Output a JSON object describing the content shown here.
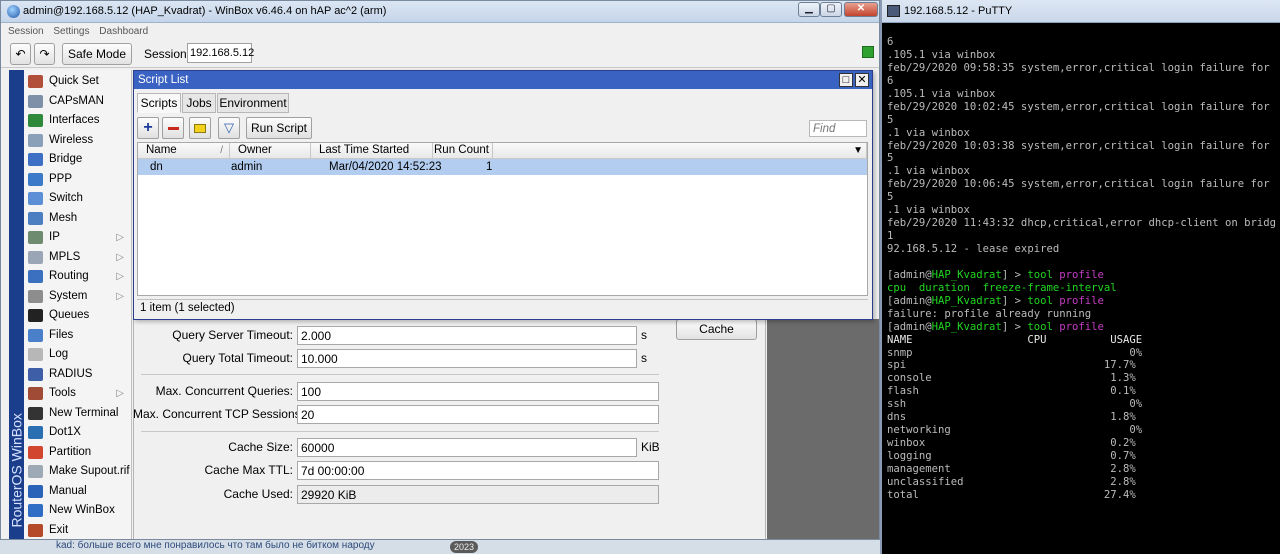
{
  "winbox": {
    "title": "admin@192.168.5.12 (HAP_Kvadrat) - WinBox v6.46.4 on hAP ac^2 (arm)",
    "menu": [
      "Session",
      "Settings",
      "Dashboard"
    ],
    "toolbar": {
      "safe_mode_label": "Safe Mode",
      "session_label": "Session:",
      "session_value": "192.168.5.12"
    },
    "brand": "RouterOS WinBox",
    "sidebar": [
      {
        "label": "Quick Set",
        "icon": "quick-set-icon",
        "color": "#b24f3a",
        "arrow": false
      },
      {
        "label": "CAPsMAN",
        "icon": "capsman-icon",
        "color": "#7e8fa8",
        "arrow": false
      },
      {
        "label": "Interfaces",
        "icon": "interfaces-icon",
        "color": "#2e8a3a",
        "arrow": false
      },
      {
        "label": "Wireless",
        "icon": "wireless-icon",
        "color": "#8aa0b8",
        "arrow": false
      },
      {
        "label": "Bridge",
        "icon": "bridge-icon",
        "color": "#3d6fc4",
        "arrow": false
      },
      {
        "label": "PPP",
        "icon": "ppp-icon",
        "color": "#3b79c9",
        "arrow": false
      },
      {
        "label": "Switch",
        "icon": "switch-icon",
        "color": "#5c8fd6",
        "arrow": false
      },
      {
        "label": "Mesh",
        "icon": "mesh-icon",
        "color": "#4c7ec2",
        "arrow": false
      },
      {
        "label": "IP",
        "icon": "ip-icon",
        "color": "#6f8b6f",
        "arrow": true
      },
      {
        "label": "MPLS",
        "icon": "mpls-icon",
        "color": "#9aa6b5",
        "arrow": true
      },
      {
        "label": "Routing",
        "icon": "routing-icon",
        "color": "#3b6fc0",
        "arrow": true
      },
      {
        "label": "System",
        "icon": "system-icon",
        "color": "#8d8d8d",
        "arrow": true
      },
      {
        "label": "Queues",
        "icon": "queues-icon",
        "color": "#222222",
        "arrow": false
      },
      {
        "label": "Files",
        "icon": "files-icon",
        "color": "#4a7fc9",
        "arrow": false
      },
      {
        "label": "Log",
        "icon": "log-icon",
        "color": "#b7b7b7",
        "arrow": false
      },
      {
        "label": "RADIUS",
        "icon": "radius-icon",
        "color": "#3f5ea8",
        "arrow": false
      },
      {
        "label": "Tools",
        "icon": "tools-icon",
        "color": "#a04b35",
        "arrow": true
      },
      {
        "label": "New Terminal",
        "icon": "terminal-icon",
        "color": "#333333",
        "arrow": false
      },
      {
        "label": "Dot1X",
        "icon": "dot1x-icon",
        "color": "#2b6fb3",
        "arrow": false
      },
      {
        "label": "Partition",
        "icon": "partition-icon",
        "color": "#d2452f",
        "arrow": false
      },
      {
        "label": "Make Supout.rif",
        "icon": "supout-icon",
        "color": "#9ea9b6",
        "arrow": false
      },
      {
        "label": "Manual",
        "icon": "manual-icon",
        "color": "#2b63b8",
        "arrow": false
      },
      {
        "label": "New WinBox",
        "icon": "winbox-icon",
        "color": "#2f6ec4",
        "arrow": false
      },
      {
        "label": "Exit",
        "icon": "exit-icon",
        "color": "#b44a2a",
        "arrow": false
      }
    ]
  },
  "script_list": {
    "title": "Script List",
    "tabs": [
      "Scripts",
      "Jobs",
      "Environment"
    ],
    "run_script_label": "Run Script",
    "find_placeholder": "Find",
    "columns": [
      "Name",
      "Owner",
      "Last Time Started",
      "Run Count"
    ],
    "rows": [
      {
        "name": "dn",
        "owner": "admin",
        "last_started": "Mar/04/2020 14:52:23",
        "run_count": "1"
      }
    ],
    "status": "1 item (1 selected)"
  },
  "dns": {
    "cache_button": "Cache",
    "fields": [
      {
        "label": "Query Server Timeout:",
        "value": "2.000",
        "unit": "s",
        "readonly": false
      },
      {
        "label": "Query Total Timeout:",
        "value": "10.000",
        "unit": "s",
        "readonly": false
      },
      {
        "label": "Max. Concurrent Queries:",
        "value": "100",
        "unit": "",
        "readonly": false
      },
      {
        "label": "Max. Concurrent TCP Sessions:",
        "value": "20",
        "unit": "",
        "readonly": false
      },
      {
        "label": "Cache Size:",
        "value": "60000",
        "unit": "KiB",
        "readonly": false
      },
      {
        "label": "Cache Max TTL:",
        "value": "7d 00:00:00",
        "unit": "",
        "readonly": false
      },
      {
        "label": "Cache Used:",
        "value": "29920 KiB",
        "unit": "",
        "readonly": true
      }
    ]
  },
  "taskbar": {
    "message": "kad: больше всего мне понравилось что там было не битком народу",
    "badge": "2023"
  },
  "putty": {
    "title": "192.168.5.12 - PuTTY",
    "lines": [
      [
        {
          "t": "6",
          "c": ""
        }
      ],
      [
        {
          "t": ".105.1 via winbox",
          "c": ""
        }
      ],
      [
        {
          "t": "feb/29/2020 09:58:35 system,error,critical login failure for",
          "c": ""
        }
      ],
      [
        {
          "t": "6",
          "c": ""
        }
      ],
      [
        {
          "t": ".105.1 via winbox",
          "c": ""
        }
      ],
      [
        {
          "t": "feb/29/2020 10:02:45 system,error,critical login failure for",
          "c": ""
        }
      ],
      [
        {
          "t": "5",
          "c": ""
        }
      ],
      [
        {
          "t": ".1 via winbox",
          "c": ""
        }
      ],
      [
        {
          "t": "feb/29/2020 10:03:38 system,error,critical login failure for",
          "c": ""
        }
      ],
      [
        {
          "t": "5",
          "c": ""
        }
      ],
      [
        {
          "t": ".1 via winbox",
          "c": ""
        }
      ],
      [
        {
          "t": "feb/29/2020 10:06:45 system,error,critical login failure for",
          "c": ""
        }
      ],
      [
        {
          "t": "5",
          "c": ""
        }
      ],
      [
        {
          "t": ".1 via winbox",
          "c": ""
        }
      ],
      [
        {
          "t": "feb/29/2020 11:43:32 dhcp,critical,error dhcp-client on bridg",
          "c": ""
        }
      ],
      [
        {
          "t": "1",
          "c": ""
        }
      ],
      [
        {
          "t": "92.168.5.12 - lease expired",
          "c": ""
        }
      ],
      [
        {
          "t": "",
          "c": ""
        }
      ],
      [
        {
          "t": "[admin@",
          "c": ""
        },
        {
          "t": "HAP_Kvadrat",
          "c": "g"
        },
        {
          "t": "] > ",
          "c": ""
        },
        {
          "t": "tool",
          "c": "g"
        },
        {
          "t": " ",
          "c": ""
        },
        {
          "t": "profile",
          "c": "m"
        }
      ],
      [
        {
          "t": "cpu  duration  freeze-frame-interval",
          "c": "g"
        }
      ],
      [
        {
          "t": "[admin@",
          "c": ""
        },
        {
          "t": "HAP_Kvadrat",
          "c": "g"
        },
        {
          "t": "] > ",
          "c": ""
        },
        {
          "t": "tool",
          "c": "g"
        },
        {
          "t": " ",
          "c": ""
        },
        {
          "t": "profile",
          "c": "m"
        }
      ],
      [
        {
          "t": "failure: profile already running",
          "c": ""
        }
      ],
      [
        {
          "t": "[admin@",
          "c": ""
        },
        {
          "t": "HAP_Kvadrat",
          "c": "g"
        },
        {
          "t": "] > ",
          "c": ""
        },
        {
          "t": "tool",
          "c": "g"
        },
        {
          "t": " ",
          "c": ""
        },
        {
          "t": "profile",
          "c": "m"
        }
      ],
      [
        {
          "t": "NAME                  CPU          USAGE",
          "c": "w"
        }
      ],
      [
        {
          "t": "snmp                                  0%",
          "c": ""
        }
      ],
      [
        {
          "t": "spi                               17.7%",
          "c": ""
        }
      ],
      [
        {
          "t": "console                            1.3%",
          "c": ""
        }
      ],
      [
        {
          "t": "flash                              0.1%",
          "c": ""
        }
      ],
      [
        {
          "t": "ssh                                   0%",
          "c": ""
        }
      ],
      [
        {
          "t": "dns                                1.8%",
          "c": ""
        }
      ],
      [
        {
          "t": "networking                            0%",
          "c": ""
        }
      ],
      [
        {
          "t": "winbox                             0.2%",
          "c": ""
        }
      ],
      [
        {
          "t": "logging                            0.7%",
          "c": ""
        }
      ],
      [
        {
          "t": "management                         2.8%",
          "c": ""
        }
      ],
      [
        {
          "t": "unclassified                       2.8%",
          "c": ""
        }
      ],
      [
        {
          "t": "total                             27.4%",
          "c": ""
        }
      ]
    ]
  }
}
